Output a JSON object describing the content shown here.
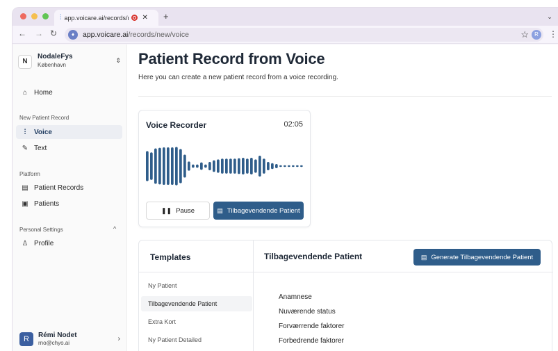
{
  "browser": {
    "tab_title": "app.voicare.ai/records/ne",
    "tab_close": "✕",
    "new_tab": "+",
    "url_host": "app.voicare.ai",
    "url_path": "/records/new/voice",
    "profile_initial": "R"
  },
  "sidebar": {
    "org_initial": "N",
    "org_name": "NodaleFys",
    "org_city": "København",
    "home": "Home",
    "section_new": "New Patient Record",
    "voice": "Voice",
    "text": "Text",
    "section_platform": "Platform",
    "patient_records": "Patient Records",
    "patients": "Patients",
    "section_personal": "Personal Settings",
    "profile": "Profile",
    "user_initial": "R",
    "user_name": "Rémi Nodet",
    "user_email": "rno@chyo.ai"
  },
  "main": {
    "title": "Patient Record from Voice",
    "subtitle": "Here you can create a new patient record from a voice recording."
  },
  "recorder": {
    "title": "Voice Recorder",
    "time": "02:05",
    "pause_label": "Pause",
    "return_label": "Tilbagevendende Patient",
    "wave_levels": [
      0.72,
      0.66,
      0.85,
      0.88,
      0.9,
      0.9,
      0.9,
      0.92,
      0.82,
      0.55,
      0.22,
      0.08,
      0.08,
      0.18,
      0.08,
      0.2,
      0.28,
      0.32,
      0.36,
      0.36,
      0.36,
      0.36,
      0.38,
      0.4,
      0.36,
      0.4,
      0.32,
      0.5,
      0.36,
      0.2,
      0.14,
      0.1,
      0.04,
      0.04,
      0.04,
      0.04,
      0.04,
      0.04
    ],
    "wave_color": "#2f5d8a"
  },
  "templates": {
    "heading": "Templates",
    "items": [
      "Ny Patient",
      "Tilbagevendende Patient",
      "Extra Kort",
      "Ny Patient Detailed"
    ],
    "active_index": 1,
    "selected_title": "Tilbagevendende Patient",
    "generate_label": "Generate Tilbagevendende Patient",
    "fields": [
      "Anamnese",
      "Nuværende status",
      "Forværrende faktorer",
      "Forbedrende faktorer"
    ]
  }
}
